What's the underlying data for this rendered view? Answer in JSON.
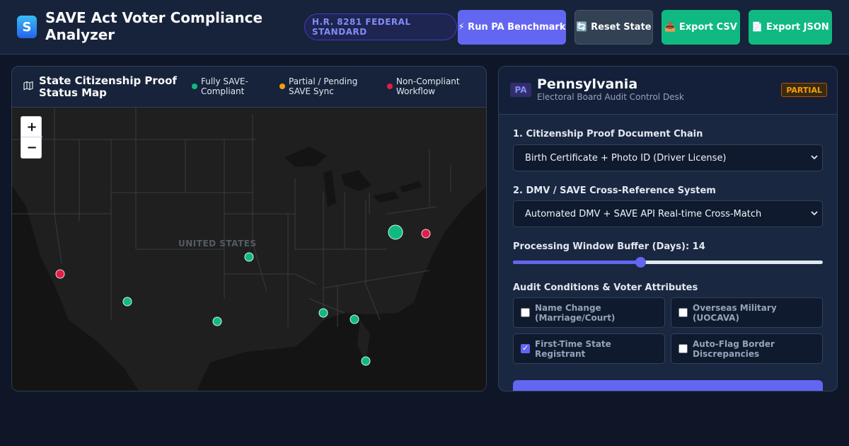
{
  "app": {
    "logo_letter": "S",
    "title": "SAVE Act Voter Compliance Analyzer",
    "standard_badge": "H.R. 8281 FEDERAL STANDARD"
  },
  "toolbar": {
    "benchmark_label": "⚡ Run PA Benchmark",
    "reset_label": "🔄 Reset State",
    "export_csv_label": "📥 Export CSV",
    "export_json_label": "📄 Export JSON"
  },
  "map": {
    "title": "State Citizenship Proof Status Map",
    "title_icon": "map-icon",
    "legend": [
      {
        "label": "Fully SAVE-Compliant",
        "color": "#10b981"
      },
      {
        "label": "Partial / Pending SAVE Sync",
        "color": "#f59e0b"
      },
      {
        "label": "Non-Compliant Workflow",
        "color": "#e11d48"
      }
    ],
    "zoom_in": "+",
    "zoom_out": "−",
    "country_label": "UNITED STATES",
    "colors": {
      "compliant": "#10b981",
      "noncompliant": "#e11d48",
      "land": "#1f1f20",
      "water": "#141414",
      "borders": "#3a3b3e"
    }
  },
  "desk": {
    "state_abbr": "PA",
    "state_name": "Pennsylvania",
    "subtitle": "Electoral Board Audit Control Desk",
    "status": "PARTIAL",
    "doc_chain_label": "1. Citizenship Proof Document Chain",
    "doc_chain_value": "Birth Certificate + Photo ID (Driver License)",
    "crossref_label": "2. DMV / SAVE Cross-Reference System",
    "crossref_value": "Automated DMV + SAVE API Real-time Cross-Match",
    "buffer_label": "Processing Window Buffer (Days): 14",
    "buffer_fraction": 0.41,
    "conditions_label": "Audit Conditions & Voter Attributes",
    "attributes": [
      {
        "label": "Name Change (Marriage/Court)",
        "checked": false
      },
      {
        "label": "Overseas Military (UOCAVA)",
        "checked": false
      },
      {
        "label": "First-Time State Registrant",
        "checked": true
      },
      {
        "label": "Auto-Flag Border Discrepancies",
        "checked": false
      }
    ]
  }
}
